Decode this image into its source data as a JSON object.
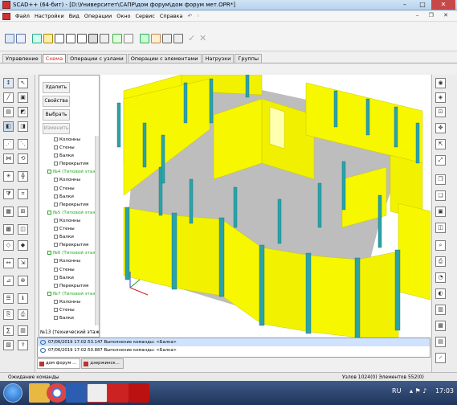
{
  "window": {
    "title": "SCAD++ (64-бит) - [D:\\Университет\\САПР\\дом форум\\дом форум мет.OPR*]",
    "controls": {
      "minimize": "–",
      "maximize": "□",
      "close": "✕"
    }
  },
  "menu": {
    "items": [
      "Файл",
      "Настройки",
      "Вид",
      "Операции",
      "Окно",
      "Сервис",
      "Справка"
    ],
    "mdi_controls": "– ❐ ✕"
  },
  "ribbon": {
    "tabs": [
      "Управление",
      "Схема",
      "Операции с узлами",
      "Операции с элементами",
      "Нагрузки",
      "Группы"
    ],
    "active_tab": "Схема"
  },
  "left_panel": {
    "buttons": [
      "Удалить",
      "Свойства",
      "Выбрать",
      "Изменить"
    ],
    "tree": [
      {
        "label": "Колонны",
        "type": "item"
      },
      {
        "label": "Стены",
        "type": "item"
      },
      {
        "label": "Балки",
        "type": "item"
      },
      {
        "label": "Перекрытия",
        "type": "item"
      },
      {
        "label": "№4 (Типовой этаж",
        "type": "floor"
      },
      {
        "label": "Колонны",
        "type": "item"
      },
      {
        "label": "Стены",
        "type": "item"
      },
      {
        "label": "Балки",
        "type": "item"
      },
      {
        "label": "Перекрытия",
        "type": "item"
      },
      {
        "label": "№5 (Типовой этаж",
        "type": "floor"
      },
      {
        "label": "Колонны",
        "type": "item"
      },
      {
        "label": "Стены",
        "type": "item"
      },
      {
        "label": "Балки",
        "type": "item"
      },
      {
        "label": "Перекрытия",
        "type": "item"
      },
      {
        "label": "№6 (Типовой этаж",
        "type": "floor"
      },
      {
        "label": "Колонны",
        "type": "item"
      },
      {
        "label": "Стены",
        "type": "item"
      },
      {
        "label": "Балки",
        "type": "item"
      },
      {
        "label": "Перекрытия",
        "type": "item"
      },
      {
        "label": "№7 (Типовой этаж",
        "type": "floor"
      },
      {
        "label": "Колонны",
        "type": "item"
      },
      {
        "label": "Стены",
        "type": "item"
      },
      {
        "label": "Балки",
        "type": "item"
      }
    ],
    "status": "№13 (технический этаж -"
  },
  "log": {
    "rows": [
      "07/06/2019 17:02:53.147 Выполнение команды: <Балка>",
      "07/06/2019 17:02:50.887 Выполнение команды: <Балка>"
    ]
  },
  "doc_tabs": [
    "дом форум ...",
    "дзержинск..."
  ],
  "status_bar": {
    "left": "Ожидание команды",
    "right": "Узлов 1024(0) Элементов 552(0)"
  },
  "taskbar": {
    "lang": "RU",
    "time": "17:03"
  },
  "colors": {
    "wall": "#f7f700",
    "wall_dark": "#e3e300",
    "column": "#2aa3a8",
    "slab": "#bdbdbd",
    "accent_tab": "#d02020"
  }
}
